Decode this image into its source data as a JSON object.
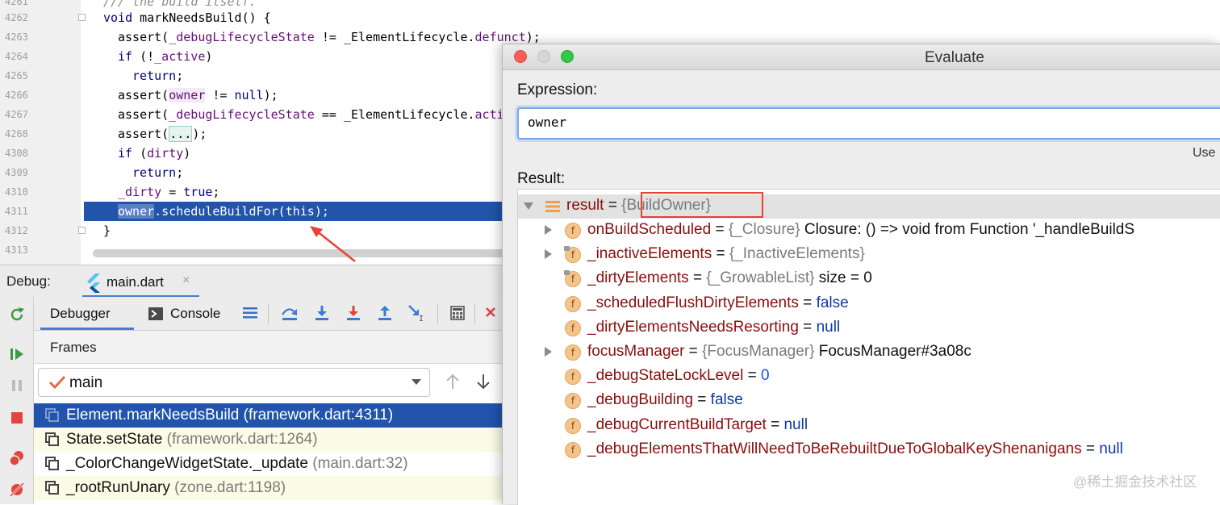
{
  "editor": {
    "lines": [
      {
        "num": "4261",
        "html_key": "l4261"
      },
      {
        "num": "4262"
      },
      {
        "num": "4263"
      },
      {
        "num": "4264"
      },
      {
        "num": "4265"
      },
      {
        "num": "4266"
      },
      {
        "num": "4267"
      },
      {
        "num": "4268"
      },
      {
        "num": "4308"
      },
      {
        "num": "4309"
      },
      {
        "num": "4310"
      },
      {
        "num": "4311"
      },
      {
        "num": "4312"
      },
      {
        "num": "4313"
      }
    ],
    "code": {
      "l4261": "/// the build itself.",
      "l4262_kw": "void",
      "l4262_rest": " markNeedsBuild() {",
      "l4263_a": "assert(",
      "l4263_f": "_debugLifecycleState",
      "l4263_b": " != _ElementLifecycle.",
      "l4263_c": "defunct",
      "l4263_d": ");",
      "l4264_kw": "if",
      "l4264_a": " (!",
      "l4264_f": "_active",
      "l4264_b": ")",
      "l4265_kw": "return",
      "l4265_b": ";",
      "l4266_a": "assert(",
      "l4266_f": "owner",
      "l4266_b": " != ",
      "l4266_kw": "null",
      "l4266_c": ");",
      "l4267_a": "assert(",
      "l4267_f": "_debugLifecycleState",
      "l4267_b": " == _ElementLifecycle.",
      "l4267_c": "acti",
      "l4268_a": "assert(",
      "l4268_fold": "...",
      "l4268_b": ");",
      "l4308_kw": "if",
      "l4308_a": " (",
      "l4308_f": "dirty",
      "l4308_b": ")",
      "l4309_kw": "return",
      "l4309_b": ";",
      "l4310_f": "_dirty",
      "l4310_a": " = ",
      "l4310_kw": "true",
      "l4310_b": ";",
      "l4311_sel": "owner",
      "l4311_rest": ".scheduleBuildFor(this);",
      "l4312": "}"
    }
  },
  "debug": {
    "label": "Debug:",
    "file_tab": "main.dart",
    "close_glyph": "×",
    "tabs": {
      "debugger": "Debugger",
      "console": "Console"
    },
    "frames_label": "Frames",
    "thread": "main",
    "frames": [
      {
        "method": "Element.markNeedsBuild",
        "loc": "(framework.dart:4311)"
      },
      {
        "method": "State.setState",
        "loc": "(framework.dart:1264)"
      },
      {
        "method": "_ColorChangeWidgetState._update",
        "loc": "(main.dart:32)"
      },
      {
        "method": "_rootRunUnary",
        "loc": "(zone.dart:1198)"
      }
    ]
  },
  "dialog": {
    "title": "Evaluate",
    "expression_label": "Expression:",
    "expression_value": "owner",
    "use_hint": "Use",
    "result_label": "Result:",
    "root": {
      "name": "result",
      "eq": " = ",
      "type": "{BuildOwner}"
    },
    "fields": [
      {
        "name": "onBuildScheduled",
        "type": "{_Closure}",
        "value": " Closure: () => void from Function '_handleBuildS",
        "expandable": true,
        "locked": false,
        "value_style": "txt"
      },
      {
        "name": "_inactiveElements",
        "type": "{_InactiveElements}",
        "value": "",
        "expandable": true,
        "locked": true,
        "value_style": "txt"
      },
      {
        "name": "_dirtyElements",
        "type": "{_GrowableList}",
        "value": " size = 0",
        "expandable": false,
        "locked": true,
        "value_style": "txt"
      },
      {
        "name": "_scheduledFlushDirtyElements",
        "type": "",
        "value": "false",
        "expandable": false,
        "locked": false,
        "value_style": "kw"
      },
      {
        "name": "_dirtyElementsNeedsResorting",
        "type": "",
        "value": "null",
        "expandable": false,
        "locked": false,
        "value_style": "kw"
      },
      {
        "name": "focusManager",
        "type": "{FocusManager}",
        "value": " FocusManager#3a08c",
        "expandable": true,
        "locked": false,
        "value_style": "txt"
      },
      {
        "name": "_debugStateLockLevel",
        "type": "",
        "value": "0",
        "expandable": false,
        "locked": false,
        "value_style": "num"
      },
      {
        "name": "_debugBuilding",
        "type": "",
        "value": "false",
        "expandable": false,
        "locked": false,
        "value_style": "kw"
      },
      {
        "name": "_debugCurrentBuildTarget",
        "type": "",
        "value": "null",
        "expandable": false,
        "locked": false,
        "value_style": "kw"
      },
      {
        "name": "_debugElementsThatWillNeedToBeRebuiltDueToGlobalKeyShenanigans",
        "type": "",
        "value": "null",
        "expandable": false,
        "locked": false,
        "value_style": "kw"
      }
    ],
    "field_glyph": "f",
    "eq": " = "
  },
  "watermark": "@稀土掘金技术社区",
  "colors": {
    "accent": "#4b7bd1",
    "selection": "#2154aa",
    "annotation": "#e94133",
    "keyword": "#000080",
    "field": "#660e7a"
  }
}
